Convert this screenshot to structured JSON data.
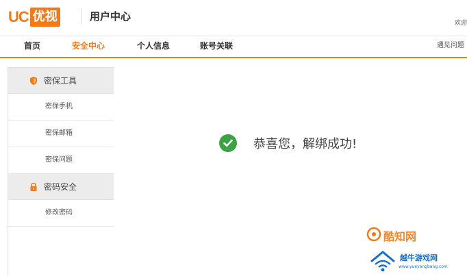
{
  "header": {
    "logo_uc": "UC",
    "logo_yoku": "优视",
    "title": "用户中心",
    "welcome": "欢迎"
  },
  "nav": {
    "items": [
      {
        "label": "首页"
      },
      {
        "label": "安全中心",
        "active": true
      },
      {
        "label": "个人信息"
      },
      {
        "label": "账号关联"
      }
    ],
    "right_link": "遇见问题"
  },
  "sidebar": {
    "sections": [
      {
        "title": "密保工具",
        "icon": "shield-icon",
        "items": [
          "密保手机",
          "密保邮箱",
          "密保问题"
        ]
      },
      {
        "title": "密码安全",
        "icon": "lock-icon",
        "items": [
          "修改密码"
        ]
      }
    ]
  },
  "main": {
    "success_message": "恭喜您，解绑成功!",
    "success_icon": "check-circle-icon"
  },
  "watermark": {
    "line1": "酷知网",
    "line2": "越牛游戏网",
    "line3": "www.yueyangbang.com"
  },
  "colors": {
    "accent": "#f07a18",
    "success": "#3ca345",
    "sidebar_head_bg": "#ececec"
  }
}
